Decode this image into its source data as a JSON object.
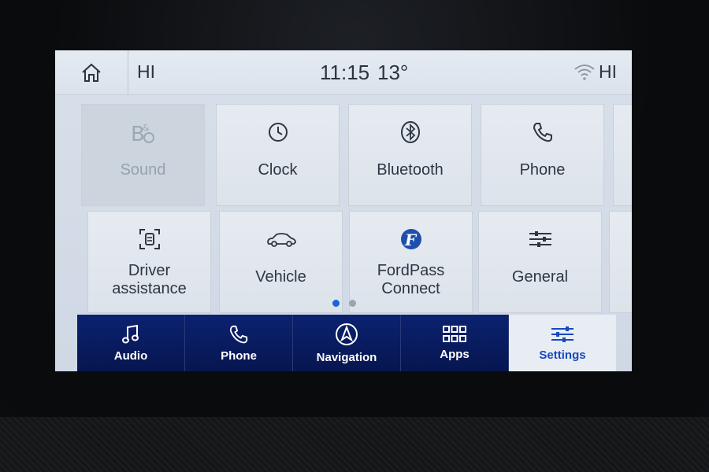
{
  "status": {
    "left_temp": "HI",
    "time": "11:15",
    "outside_temp": "13°",
    "right_temp": "HI"
  },
  "tiles": [
    {
      "label": "Sound",
      "icon": "bo-sound-icon",
      "enabled": false
    },
    {
      "label": "Clock",
      "icon": "clock-icon",
      "enabled": true
    },
    {
      "label": "Bluetooth",
      "icon": "bluetooth-icon",
      "enabled": true
    },
    {
      "label": "Phone",
      "icon": "phone-icon",
      "enabled": true
    },
    {
      "label_line1": "Driver",
      "label_line2": "assistance",
      "icon": "driver-assist-icon",
      "enabled": true
    },
    {
      "label": "Vehicle",
      "icon": "car-icon",
      "enabled": true
    },
    {
      "label_line1": "FordPass",
      "label_line2": "Connect",
      "icon": "fordpass-icon",
      "enabled": true
    },
    {
      "label": "General",
      "icon": "sliders-icon",
      "enabled": true
    }
  ],
  "pagination": {
    "pages": 2,
    "current": 1
  },
  "nav": [
    {
      "label": "Audio",
      "icon": "music-note-icon"
    },
    {
      "label": "Phone",
      "icon": "phone-icon"
    },
    {
      "label": "Navigation",
      "icon": "compass-icon"
    },
    {
      "label": "Apps",
      "icon": "apps-grid-icon"
    },
    {
      "label": "Settings",
      "icon": "sliders-icon",
      "active": true
    }
  ],
  "colors": {
    "nav_bg": "#08195a",
    "accent": "#1748c0",
    "page_dot_active": "#1a63d8",
    "screen_bg": "#d7dfea"
  }
}
